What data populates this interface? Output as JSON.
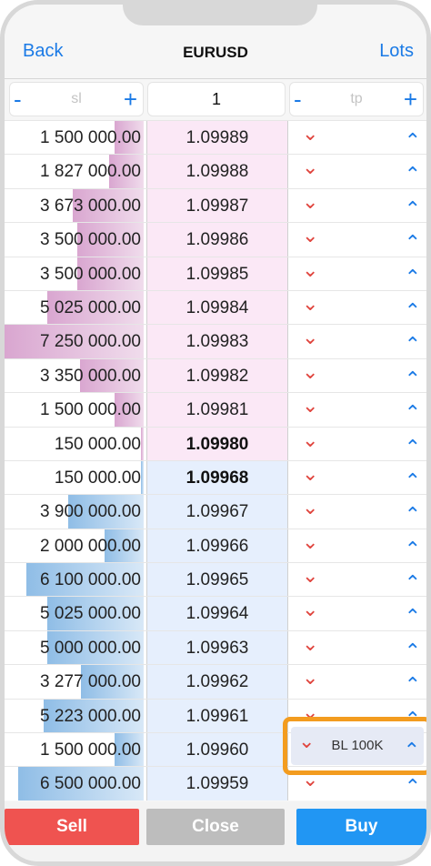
{
  "nav": {
    "back": "Back",
    "title": "EURUSD",
    "lots": "Lots"
  },
  "inputs": {
    "sl": {
      "minus": "-",
      "placeholder": "sl",
      "plus": "+"
    },
    "lot_value": "1",
    "tp": {
      "minus": "-",
      "placeholder": "tp",
      "plus": "+"
    }
  },
  "book": {
    "rows": [
      {
        "side": "ask",
        "volume": "1 500 000.00",
        "price": "1.09989",
        "depth": 0.21
      },
      {
        "side": "ask",
        "volume": "1 827 000.00",
        "price": "1.09988",
        "depth": 0.25
      },
      {
        "side": "ask",
        "volume": "3 673 000.00",
        "price": "1.09987",
        "depth": 0.51
      },
      {
        "side": "ask",
        "volume": "3 500 000.00",
        "price": "1.09986",
        "depth": 0.48
      },
      {
        "side": "ask",
        "volume": "3 500 000.00",
        "price": "1.09985",
        "depth": 0.48
      },
      {
        "side": "ask",
        "volume": "5 025 000.00",
        "price": "1.09984",
        "depth": 0.69
      },
      {
        "side": "ask",
        "volume": "7 250 000.00",
        "price": "1.09983",
        "depth": 1.0
      },
      {
        "side": "ask",
        "volume": "3 350 000.00",
        "price": "1.09982",
        "depth": 0.46
      },
      {
        "side": "ask",
        "volume": "1 500 000.00",
        "price": "1.09981",
        "depth": 0.21
      },
      {
        "side": "ask",
        "volume": "150 000.00",
        "price": "1.09980",
        "depth": 0.02,
        "best": true
      },
      {
        "side": "bid",
        "volume": "150 000.00",
        "price": "1.09968",
        "depth": 0.02,
        "best": true
      },
      {
        "side": "bid",
        "volume": "3 900 000.00",
        "price": "1.09967",
        "depth": 0.54
      },
      {
        "side": "bid",
        "volume": "2 000 000.00",
        "price": "1.09966",
        "depth": 0.28
      },
      {
        "side": "bid",
        "volume": "6 100 000.00",
        "price": "1.09965",
        "depth": 0.84
      },
      {
        "side": "bid",
        "volume": "5 025 000.00",
        "price": "1.09964",
        "depth": 0.69
      },
      {
        "side": "bid",
        "volume": "5 000 000.00",
        "price": "1.09963",
        "depth": 0.69
      },
      {
        "side": "bid",
        "volume": "3 277 000.00",
        "price": "1.09962",
        "depth": 0.45
      },
      {
        "side": "bid",
        "volume": "5 223 000.00",
        "price": "1.09961",
        "depth": 0.72
      },
      {
        "side": "bid",
        "volume": "1 500 000.00",
        "price": "1.09960",
        "depth": 0.21
      },
      {
        "side": "bid",
        "volume": "6 500 000.00",
        "price": "1.09959",
        "depth": 0.9
      }
    ],
    "sell_icon": "chevron-down-icon",
    "buy_icon": "chevron-up-icon"
  },
  "order_marker": {
    "label": "BL 100K",
    "row_price": "1.09960"
  },
  "footer": {
    "sell": "Sell",
    "close": "Close",
    "buy": "Buy"
  },
  "colors": {
    "accent": "#1a7ae6",
    "sell": "#ef5350",
    "buy": "#2196f3",
    "close": "#bdbdbd",
    "ask_bg": "#fbe8f6",
    "bid_bg": "#e6effd",
    "highlight": "#f39c1f"
  }
}
